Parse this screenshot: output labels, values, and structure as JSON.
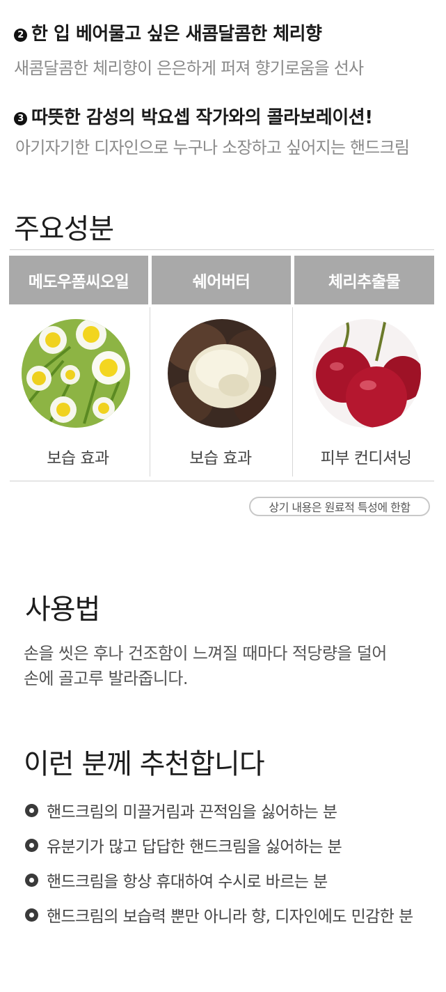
{
  "features": [
    {
      "num": "2",
      "title": "한 입 베어물고 싶은 새콤달콤한 체리향",
      "desc": "새콤달콤한 체리향이 은은하게 퍼져 향기로움을 선사"
    },
    {
      "num": "3",
      "title": "따뜻한 감성의 박요셉 작가와의 콜라보레이션!",
      "desc": "아기자기한 디자인으로 누구나 소장하고 싶어지는 핸드크림"
    }
  ],
  "ingredients_section": {
    "heading": "주요성분",
    "columns": [
      {
        "name": "메도우폼씨오일",
        "effect": "보습 효과",
        "icon": "meadowfoam-flower-image"
      },
      {
        "name": "쉐어버터",
        "effect": "보습 효과",
        "icon": "shea-butter-image"
      },
      {
        "name": "체리추출물",
        "effect": "피부 컨디셔닝",
        "icon": "cherry-image"
      }
    ],
    "note": "상기 내용은 원료적 특성에 한함"
  },
  "usage": {
    "heading": "사용법",
    "line1": "손을 씻은 후나 건조함이 느껴질 때마다 적당량을 덜어",
    "line2": "손에 골고루 발라줍니다."
  },
  "recommend": {
    "heading": "이런 분께 추천합니다",
    "items": [
      "핸드크림의 미끌거림과 끈적임을 싫어하는 분",
      "유분기가 많고 답답한 핸드크림을 싫어하는 분",
      "핸드크림을 항상 휴대하여 수시로 바르는 분",
      "핸드크림의 보습력 뿐만 아니라 향, 디자인에도 민감한 분"
    ]
  }
}
